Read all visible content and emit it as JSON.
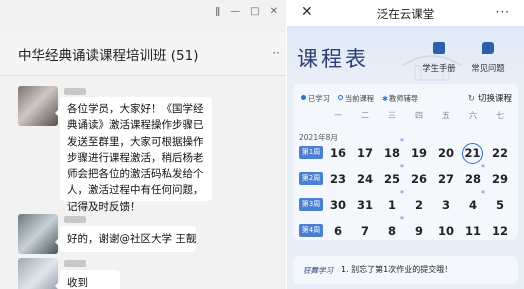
{
  "chat": {
    "window_controls": [
      "ǁ",
      "—",
      "□",
      "✕"
    ],
    "title": "中华经典诵读课程培训班 (51)",
    "more_glyph": "··",
    "messages": [
      {
        "text": "各位学员，大家好！《国学经典诵读》激活课程操作步骤已发送至群里，大家可根据操作步骤进行课程激活，稍后杨老师会把各位的激活码私发给个人，激活过程中有任何问题，记得及时反馈！"
      },
      {
        "text": "好的，谢谢@社区大学 王靓"
      },
      {
        "text": "收到"
      }
    ]
  },
  "miniapp": {
    "nav": {
      "close": "✕",
      "title": "泛在云课堂",
      "more": "···"
    },
    "heading": "课程表",
    "links": [
      {
        "label": "学生手册",
        "icon": "student-handbook-icon"
      },
      {
        "label": "常见问题",
        "icon": "faq-icon"
      }
    ],
    "legend": [
      {
        "label": "已学习",
        "icon": "filled-dot"
      },
      {
        "label": "当前课程",
        "icon": "hollow-dot"
      },
      {
        "label": "教师辅导",
        "icon": "star"
      }
    ],
    "switch_label": "切换课程",
    "weekdays": [
      "一",
      "二",
      "三",
      "四",
      "五",
      "六",
      "七"
    ],
    "month_label": "2021年8月",
    "weeks": [
      {
        "label": "第1周",
        "days": [
          "16",
          "17",
          "18",
          "19",
          "20",
          "21",
          "22"
        ],
        "marks": [
          2
        ],
        "today": 5
      },
      {
        "label": "第2周",
        "days": [
          "23",
          "24",
          "25",
          "26",
          "27",
          "28",
          "29"
        ],
        "marks": [
          2,
          5
        ],
        "today": -1
      },
      {
        "label": "第3周",
        "days": [
          "30",
          "31",
          "1",
          "2",
          "3",
          "4",
          "5"
        ],
        "marks": [
          2,
          5
        ],
        "today": -1
      },
      {
        "label": "第4周",
        "days": [
          "6",
          "7",
          "8",
          "9",
          "10",
          "11",
          "12"
        ],
        "marks": [
          2
        ],
        "today": -1
      }
    ],
    "notice": {
      "tag": "狂舞学习",
      "text": "1. 别忘了第1次作业的提交哦！"
    },
    "accent_color": "#2c6fd6",
    "heading_color": "#2a3f74"
  }
}
